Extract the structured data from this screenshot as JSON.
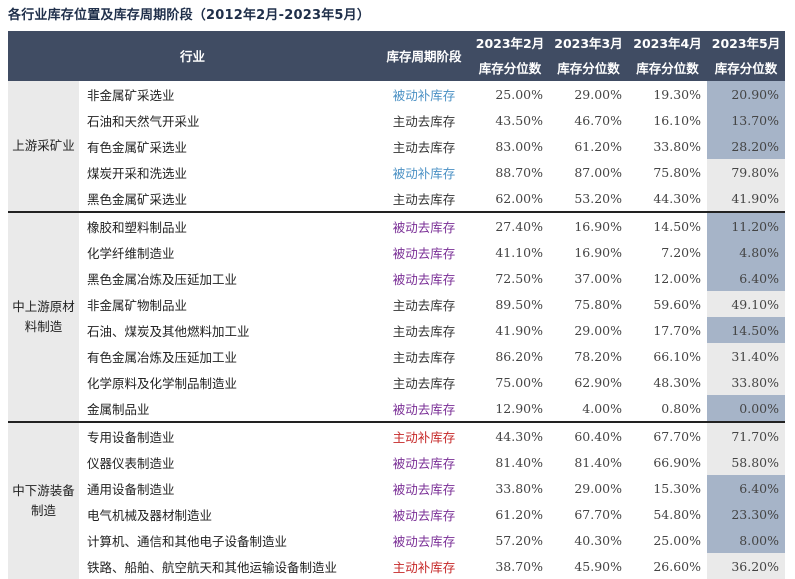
{
  "title": "各行业库存位置及库存周期阶段（2012年2月-2023年5月）",
  "headers": {
    "industry": "行业",
    "phase": "库存周期阶段",
    "months": [
      "2023年2月",
      "2023年3月",
      "2023年4月",
      "2023年5月"
    ],
    "sub": "库存分位数"
  },
  "phase_colors": {
    "被动补库存": "#4a90c4",
    "主动去库存": "#333333",
    "被动去库存": "#7a2f96",
    "主动补库存": "#c62828"
  },
  "groups": [
    {
      "name": "上游采矿业",
      "rows": [
        {
          "industry": "非金属矿采选业",
          "phase": "被动补库存",
          "v": [
            "25.00%",
            "29.00%",
            "19.30%",
            "20.90%"
          ],
          "hl": true
        },
        {
          "industry": "石油和天然气开采业",
          "phase": "主动去库存",
          "v": [
            "43.50%",
            "46.70%",
            "16.10%",
            "13.70%"
          ],
          "hl": true
        },
        {
          "industry": "有色金属矿采选业",
          "phase": "主动去库存",
          "v": [
            "83.00%",
            "61.20%",
            "33.80%",
            "28.20%"
          ],
          "hl": true
        },
        {
          "industry": "煤炭开采和洗选业",
          "phase": "被动补库存",
          "v": [
            "88.70%",
            "87.00%",
            "75.80%",
            "79.80%"
          ],
          "hl": false
        },
        {
          "industry": "黑色金属矿采选业",
          "phase": "主动去库存",
          "v": [
            "62.00%",
            "53.20%",
            "44.30%",
            "41.90%"
          ],
          "hl": false
        }
      ]
    },
    {
      "name": "中上游原材料制造",
      "rows": [
        {
          "industry": "橡胶和塑料制品业",
          "phase": "被动去库存",
          "v": [
            "27.40%",
            "16.90%",
            "14.50%",
            "11.20%"
          ],
          "hl": true
        },
        {
          "industry": "化学纤维制造业",
          "phase": "被动去库存",
          "v": [
            "41.10%",
            "16.90%",
            "7.20%",
            "4.80%"
          ],
          "hl": true
        },
        {
          "industry": "黑色金属冶炼及压延加工业",
          "phase": "被动去库存",
          "v": [
            "72.50%",
            "37.00%",
            "12.00%",
            "6.40%"
          ],
          "hl": true
        },
        {
          "industry": "非金属矿物制品业",
          "phase": "主动去库存",
          "v": [
            "89.50%",
            "75.80%",
            "59.60%",
            "49.10%"
          ],
          "hl": false
        },
        {
          "industry": "石油、煤炭及其他燃料加工业",
          "phase": "主动去库存",
          "v": [
            "41.90%",
            "29.00%",
            "17.70%",
            "14.50%"
          ],
          "hl": true
        },
        {
          "industry": "有色金属冶炼及压延加工业",
          "phase": "主动去库存",
          "v": [
            "86.20%",
            "78.20%",
            "66.10%",
            "31.40%"
          ],
          "hl": false
        },
        {
          "industry": "化学原料及化学制品制造业",
          "phase": "主动去库存",
          "v": [
            "75.00%",
            "62.90%",
            "48.30%",
            "33.80%"
          ],
          "hl": false
        },
        {
          "industry": "金属制品业",
          "phase": "被动去库存",
          "v": [
            "12.90%",
            "4.00%",
            "0.80%",
            "0.00%"
          ],
          "hl": true
        }
      ]
    },
    {
      "name": "中下游装备制造",
      "rows": [
        {
          "industry": "专用设备制造业",
          "phase": "主动补库存",
          "v": [
            "44.30%",
            "60.40%",
            "67.70%",
            "71.70%"
          ],
          "hl": false
        },
        {
          "industry": "仪器仪表制造业",
          "phase": "被动去库存",
          "v": [
            "81.40%",
            "81.40%",
            "66.90%",
            "58.80%"
          ],
          "hl": false
        },
        {
          "industry": "通用设备制造业",
          "phase": "被动去库存",
          "v": [
            "33.80%",
            "29.00%",
            "15.30%",
            "6.40%"
          ],
          "hl": true
        },
        {
          "industry": "电气机械及器材制造业",
          "phase": "被动去库存",
          "v": [
            "61.20%",
            "67.70%",
            "54.80%",
            "23.30%"
          ],
          "hl": true
        },
        {
          "industry": "计算机、通信和其他电子设备制造业",
          "phase": "被动去库存",
          "v": [
            "57.20%",
            "40.30%",
            "25.00%",
            "8.00%"
          ],
          "hl": true
        },
        {
          "industry": "铁路、船舶、航空航天和其他运输设备制造业",
          "phase": "主动补库存",
          "v": [
            "38.70%",
            "45.90%",
            "26.60%",
            "36.20%"
          ],
          "hl": false
        }
      ]
    }
  ]
}
